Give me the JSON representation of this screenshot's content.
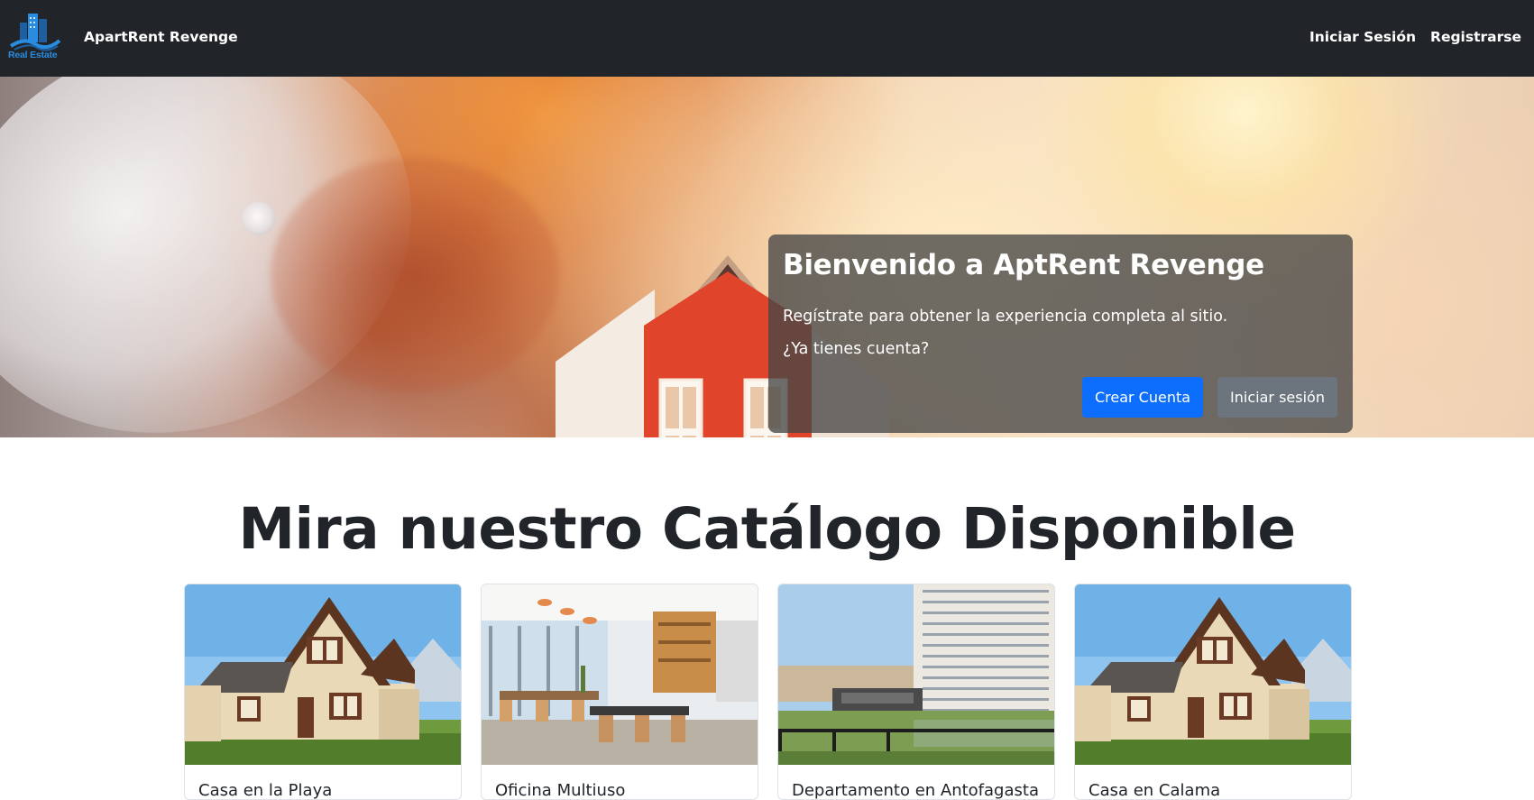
{
  "navbar": {
    "logo_text": "Real Estate",
    "brand": "ApartRent Revenge",
    "links": [
      "Iniciar Sesión",
      "Registrarse"
    ]
  },
  "hero": {
    "title": "Bienvenido a AptRent Revenge",
    "text": "Regístrate para obtener la experiencia completa al sitio.",
    "question": "¿Ya tienes cuenta?",
    "primary_button": "Crear Cuenta",
    "secondary_button": "Iniciar sesión"
  },
  "catalog": {
    "title": "Mira nuestro Catálogo Disponible",
    "cards": [
      {
        "title": "Casa en la Playa",
        "image": "house"
      },
      {
        "title": "Oficina Multiuso",
        "image": "office"
      },
      {
        "title": "Departamento en Antofagasta",
        "image": "building"
      },
      {
        "title": "Casa en Calama",
        "image": "house"
      }
    ]
  },
  "colors": {
    "navbar": "#212529",
    "primary": "#0d6efd",
    "secondary": "#6c757d",
    "logo_blue": "#2a8ce0"
  }
}
